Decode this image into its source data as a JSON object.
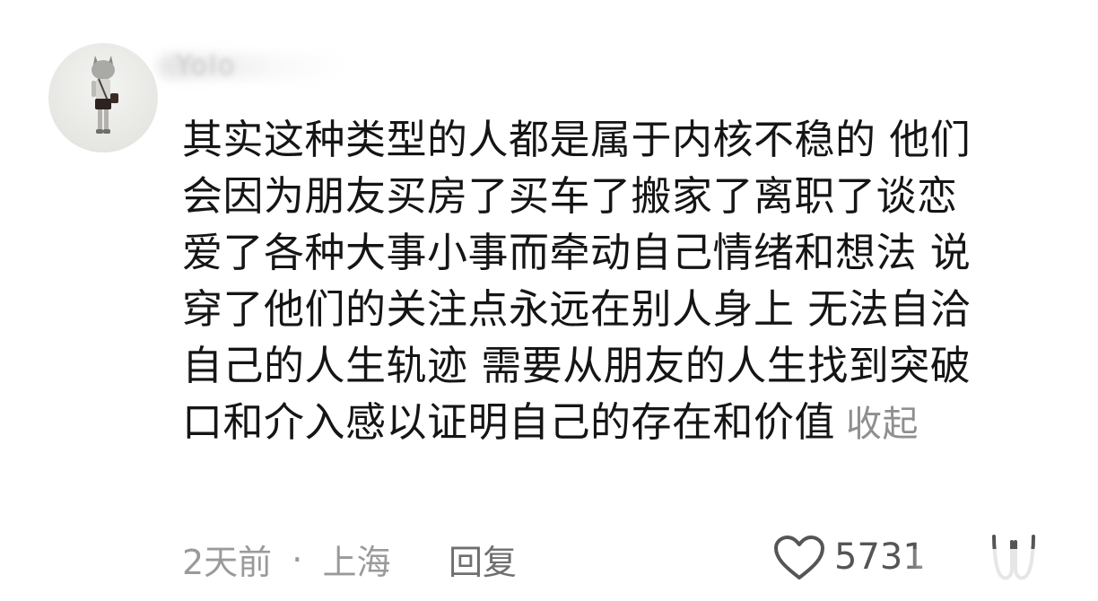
{
  "comment": {
    "username": "Yolo",
    "avatar": "figurine-avatar",
    "lines": [
      "其实这种类型的人都是属于内核不稳的 他们",
      "会因为朋友买房了买车了搬家了离职了谈恋",
      "爱了各种大事小事而牵动自己情绪和想法 说",
      "穿了他们的关注点永远在别人身上 无法自洽",
      "自己的人生轨迹 需要从朋友的人生找到突破",
      "口和介入感以证明自己的存在和价值"
    ],
    "collapse_label": "收起",
    "time": "2天前",
    "separator": "·",
    "location": "上海",
    "reply_label": "回复",
    "like_count": "5731",
    "like_icon": "heart-outline-icon",
    "dislike_icon": "dislike-icon"
  }
}
